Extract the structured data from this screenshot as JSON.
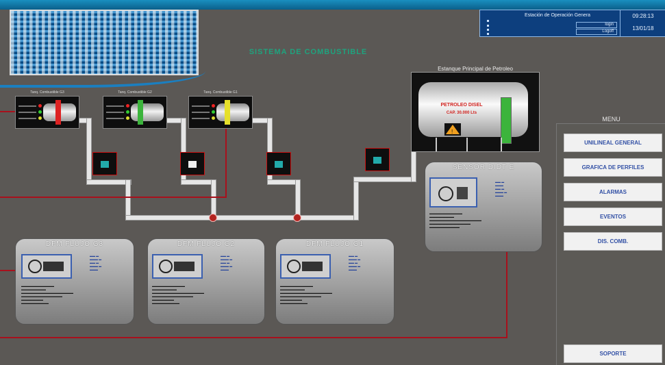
{
  "header": {
    "station": "Estación de Operación Genera",
    "time": "09:28:13",
    "date": "13/01/18",
    "login": "login",
    "logoff": "Logoff"
  },
  "title": "SISTEMA DE COMBUSTIBLE",
  "units": [
    {
      "label": "Tanq. Combustible G3"
    },
    {
      "label": "Tanq. Combustible G2"
    },
    {
      "label": "Tanq. Combustible G1"
    }
  ],
  "main_tank": {
    "label": "Estanque Principal de Petroleo",
    "name": "PETROLEO DISEL",
    "capacity": "CAP. 30.000 Lts"
  },
  "cards": [
    {
      "title": "DFM FLUJO G3"
    },
    {
      "title": "DFM FLUJO G2"
    },
    {
      "title": "DFM FLUJO G1"
    },
    {
      "title": "SENSOR DIDT E"
    }
  ],
  "menu": {
    "title": "MENU",
    "items": [
      "UNILINEAL GENERAL",
      "GRAFICA DE PERFILES",
      "ALARMAS",
      "EVENTOS",
      "DIS. COMB."
    ],
    "support": "SOPORTE"
  },
  "colors": {
    "background": "#5b5855",
    "title": "#1fa37e",
    "signal_line": "#a8101c",
    "menu_text": "#3250a5"
  }
}
